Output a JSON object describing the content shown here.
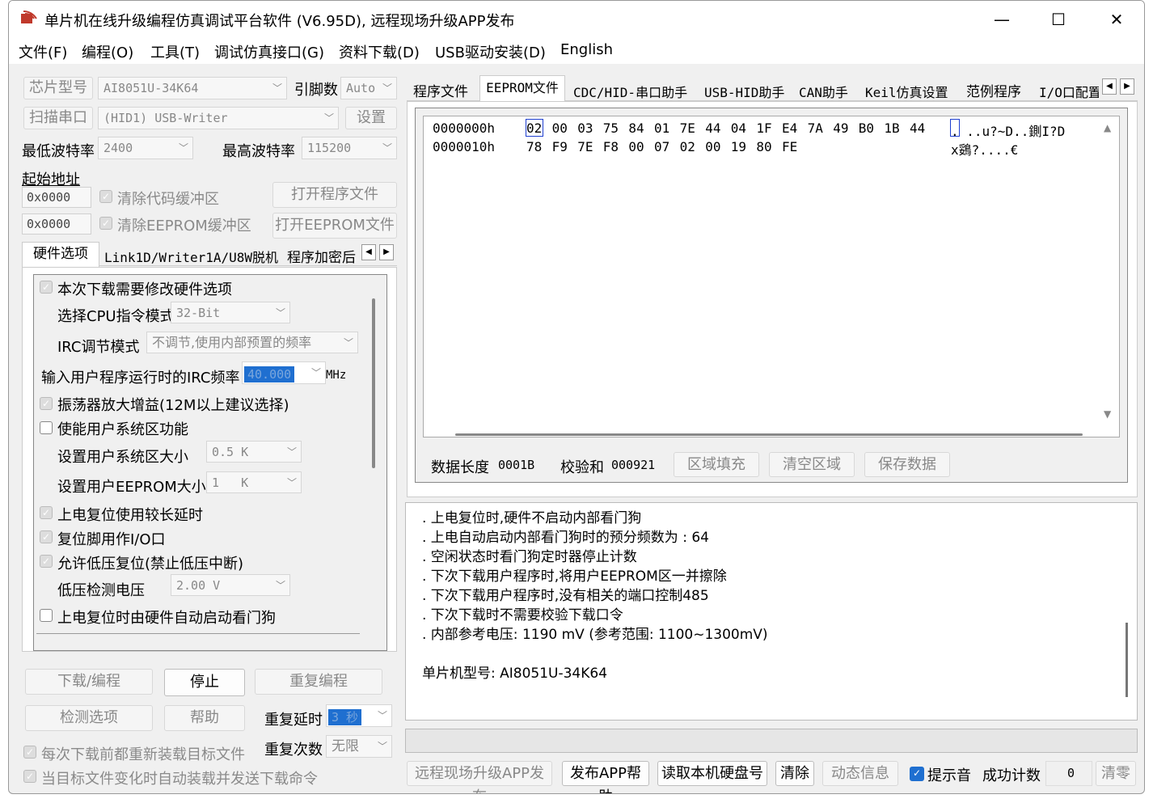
{
  "window": {
    "title": "单片机在线升级编程仿真调试平台软件 (V6.95D), 远程现场升级APP发布"
  },
  "menu": [
    "文件(F)",
    "编程(O)",
    "工具(T)",
    "调试仿真接口(G)",
    "资料下载(D)",
    "USB驱动安装(D)",
    "English"
  ],
  "left": {
    "chip_label": "芯片型号",
    "chip_value": "AI8051U-34K64",
    "pins_label": "引脚数",
    "pins_value": "Auto",
    "scan_button": "扫描串口",
    "port_value": "(HID1) USB-Writer",
    "settings_button": "设置",
    "min_baud_label": "最低波特率",
    "min_baud_value": "2400",
    "max_baud_label": "最高波特率",
    "max_baud_value": "115200",
    "start_addr_label": "起始地址",
    "addr1": "0x0000",
    "addr2": "0x0000",
    "clear_code": "清除代码缓冲区",
    "clear_eeprom": "清除EEPROM缓冲区",
    "open_prog": "打开程序文件",
    "open_eeprom": "打开EEPROM文件",
    "tabs": [
      "硬件选项",
      "Link1D/Writer1A/U8W脱机",
      "程序加密后"
    ],
    "hw": {
      "opt_modify": "本次下载需要修改硬件选项",
      "cpu_mode_label": "选择CPU指令模式",
      "cpu_mode_value": "32-Bit",
      "irc_mode_label": "IRC调节模式",
      "irc_mode_value": "不调节,使用内部预置的频率",
      "irc_freq_label": "输入用户程序运行时的IRC频率",
      "irc_freq_value": "40.000",
      "irc_freq_unit": "MHz",
      "osc_gain": "振荡器放大增益(12M以上建议选择)",
      "user_sys": "使能用户系统区功能",
      "user_sys_size_label": "设置用户系统区大小",
      "user_sys_size_value": "0.5 K",
      "eeprom_size_label": "设置用户EEPROM大小",
      "eeprom_size_value": "1   K",
      "long_delay": "上电复位使用较长延时",
      "reset_io": "复位脚用作I/O口",
      "lvr": "允许低压复位(禁止低压中断)",
      "lvd_label": "低压检测电压",
      "lvd_value": "2.00 V",
      "wdt": "上电复位时由硬件自动启动看门狗"
    },
    "download_btn": "下载/编程",
    "stop_btn": "停止",
    "reprog_btn": "重复编程",
    "detect_btn": "检测选项",
    "help_btn": "帮助",
    "repeat_delay_label": "重复延时",
    "repeat_delay_value": "3 秒",
    "repeat_count_label": "重复次数",
    "repeat_count_value": "无限",
    "reload_each": "每次下载前都重新装载目标文件",
    "auto_reload": "当目标文件变化时自动装载并发送下载命令"
  },
  "right": {
    "tabs": [
      "程序文件",
      "EEPROM文件",
      "CDC/HID-串口助手",
      "USB-HID助手",
      "CAN助手",
      "Keil仿真设置",
      "范例程序",
      "I/O口配置"
    ],
    "hex": [
      {
        "addr": "0000000h",
        "bytes": [
          "02",
          "00",
          "03",
          "75",
          "84",
          "01",
          "7E",
          "44",
          "04",
          "1F",
          "E4",
          "7A",
          "49",
          "B0",
          "1B",
          "44"
        ],
        "ascii": ". ..u?~D..鍘I?D"
      },
      {
        "addr": "0000010h",
        "bytes": [
          "78",
          "F9",
          "7E",
          "F8",
          "00",
          "07",
          "02",
          "00",
          "19",
          "80",
          "FE"
        ],
        "ascii": "x鵎?....€"
      }
    ],
    "data_len_label": "数据长度",
    "data_len_value": "0001B",
    "checksum_label": "校验和",
    "checksum_value": "000921",
    "fill_btn": "区域填充",
    "clear_area_btn": "清空区域",
    "save_btn": "保存数据",
    "log": [
      ". 上电复位时,硬件不启动内部看门狗",
      ". 上电自动启动内部看门狗时的预分频数为 : 64",
      ". 空闲状态时看门狗定时器停止计数",
      ". 下次下载用户程序时,将用户EEPROM区一并擦除",
      ". 下次下载用户程序时,没有相关的端口控制485",
      ". 下次下载时不需要校验下载口令",
      ". 内部参考电压: 1190 mV (参考范围: 1100~1300mV)",
      "",
      "单片机型号: AI8051U-34K64"
    ],
    "bottom": {
      "remote_app": "远程现场升级APP发布",
      "publish_help": "发布APP帮助",
      "read_disk": "读取本机硬盘号",
      "clear": "清除",
      "dynamic": "动态信息",
      "beep": "提示音",
      "success_label": "成功计数",
      "success_value": "0",
      "zero": "清零"
    }
  }
}
